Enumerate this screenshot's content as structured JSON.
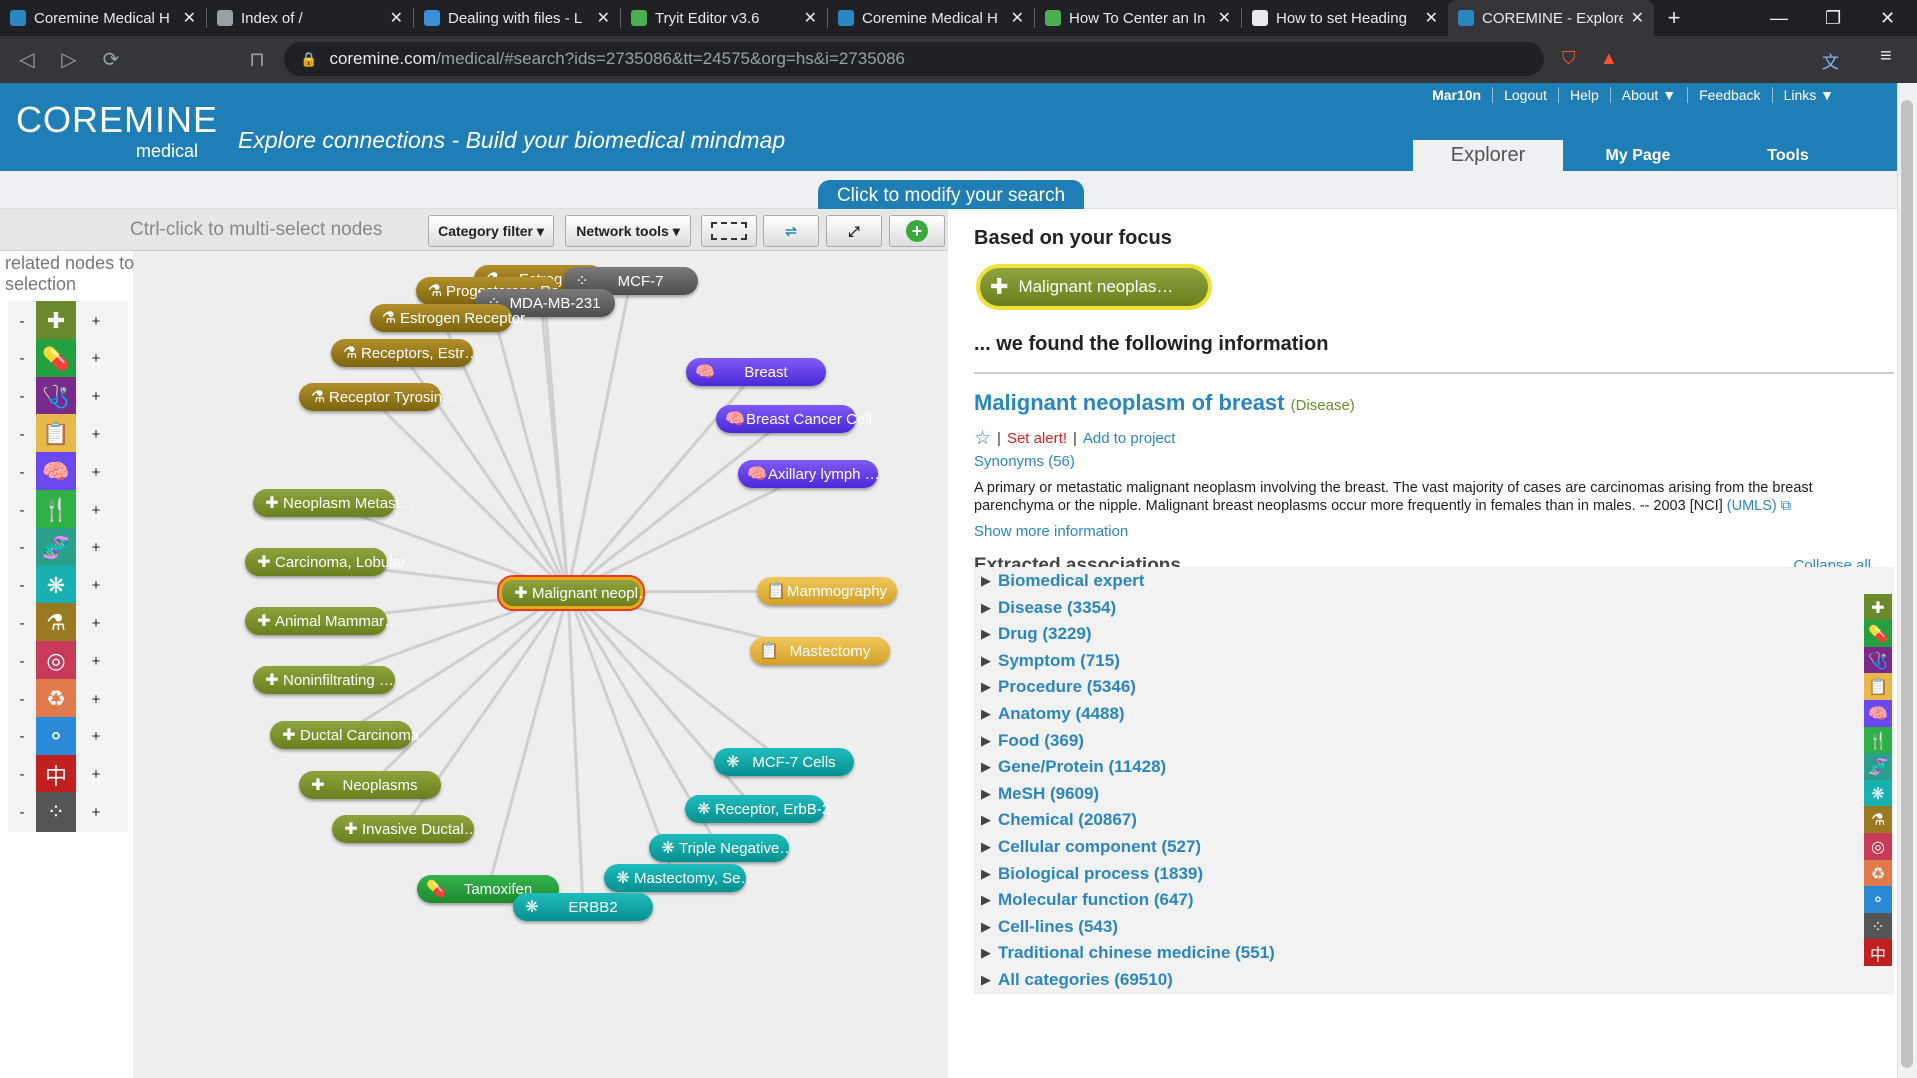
{
  "browser": {
    "tabs": [
      {
        "title": "Coremine Medical H",
        "color": "#2a86c2"
      },
      {
        "title": "Index of /",
        "color": "#9aa0a6"
      },
      {
        "title": "Dealing with files - L",
        "color": "#3b8ed8"
      },
      {
        "title": "Tryit Editor v3.6",
        "color": "#4caf50"
      },
      {
        "title": "Coremine Medical H",
        "color": "#2a86c2"
      },
      {
        "title": "How To Center an In",
        "color": "#4caf50"
      },
      {
        "title": "How to set Heading",
        "color": "#e8eaed"
      },
      {
        "title": "COREMINE - Explore",
        "color": "#2a86c2"
      }
    ],
    "url_host": "coremine.com",
    "url_path": "/medical/#search?ids=2735086&tt=24575&org=hs&i=2735086"
  },
  "header": {
    "logo_main": "COREMINE",
    "logo_sub": "medical",
    "tagline": "Explore connections - Build your biomedical mindmap",
    "links": [
      "Mar10n",
      "Logout",
      "Help",
      "About ▼",
      "Feedback",
      "Links ▼"
    ],
    "nav_tabs": [
      "Explorer",
      "My Page",
      "Tools"
    ]
  },
  "modify_search": "Click to modify your search",
  "left": {
    "hint": "Ctrl-click to multi-select nodes",
    "category_filter": "Category filter",
    "network_tools": "Network tools",
    "sidebar_title": "related nodes to selection",
    "categories": [
      {
        "icon": "✚",
        "color": "#6b8a2d"
      },
      {
        "icon": "💊",
        "color": "#25a040"
      },
      {
        "icon": "🩺",
        "color": "#7a2a8a"
      },
      {
        "icon": "📋",
        "color": "#e7b94a"
      },
      {
        "icon": "🧠",
        "color": "#6a4af0"
      },
      {
        "icon": "🍴",
        "color": "#2fb044"
      },
      {
        "icon": "🧬",
        "color": "#2aa08a"
      },
      {
        "icon": "❋",
        "color": "#18b0b0"
      },
      {
        "icon": "⚗",
        "color": "#9a7a20"
      },
      {
        "icon": "◎",
        "color": "#c83a5a"
      },
      {
        "icon": "♻",
        "color": "#e07a4a"
      },
      {
        "icon": "⚬",
        "color": "#2a8ad8"
      },
      {
        "icon": "中",
        "color": "#c02020"
      },
      {
        "icon": "⁘",
        "color": "#555555"
      }
    ]
  },
  "graph": {
    "center": "Malignant neopl…",
    "nodes": [
      {
        "label": "Estrogen",
        "icon": "⚗",
        "cat": "chem"
      },
      {
        "label": "Progesterone Re…",
        "icon": "⚗",
        "cat": "chem"
      },
      {
        "label": "MCF-7",
        "icon": "⁘",
        "cat": "cell"
      },
      {
        "label": "MDA-MB-231",
        "icon": "⁘",
        "cat": "cell"
      },
      {
        "label": "Estrogen Receptor",
        "icon": "⚗",
        "cat": "chem"
      },
      {
        "label": "Receptors, Estr…",
        "icon": "⚗",
        "cat": "chem"
      },
      {
        "label": "Receptor Tyrosin…",
        "icon": "⚗",
        "cat": "chem"
      },
      {
        "label": "Breast",
        "icon": "🧠",
        "cat": "anat"
      },
      {
        "label": "Breast Cancer Cell",
        "icon": "🧠",
        "cat": "anat"
      },
      {
        "label": "Axillary lymph …",
        "icon": "🧠",
        "cat": "anat"
      },
      {
        "label": "Neoplasm Metast…",
        "icon": "✚",
        "cat": "dis"
      },
      {
        "label": "Carcinoma, Lobular",
        "icon": "✚",
        "cat": "dis"
      },
      {
        "label": "Mammography",
        "icon": "📋",
        "cat": "proc"
      },
      {
        "label": "Animal Mammar…",
        "icon": "✚",
        "cat": "dis"
      },
      {
        "label": "Mastectomy",
        "icon": "📋",
        "cat": "proc"
      },
      {
        "label": "Noninfiltrating …",
        "icon": "✚",
        "cat": "dis"
      },
      {
        "label": "Ductal Carcinoma",
        "icon": "✚",
        "cat": "dis"
      },
      {
        "label": "MCF-7 Cells",
        "icon": "❋",
        "cat": "mesh"
      },
      {
        "label": "Neoplasms",
        "icon": "✚",
        "cat": "dis"
      },
      {
        "label": "Receptor, ErbB-2",
        "icon": "❋",
        "cat": "mesh"
      },
      {
        "label": "Invasive Ductal…",
        "icon": "✚",
        "cat": "dis"
      },
      {
        "label": "Triple Negative…",
        "icon": "❋",
        "cat": "mesh"
      },
      {
        "label": "Mastectomy, Se…",
        "icon": "❋",
        "cat": "mesh"
      },
      {
        "label": "Tamoxifen",
        "icon": "💊",
        "cat": "drug"
      },
      {
        "label": "ERBB2",
        "icon": "❋",
        "cat": "mesh"
      }
    ]
  },
  "right": {
    "based_on": "Based on your focus",
    "focus_label": "Malignant neoplas…",
    "found": "... we found the following information",
    "title": "Malignant neoplasm of breast",
    "type": "(Disease)",
    "set_alert": "Set alert!",
    "add_project": "Add to project",
    "synonyms": "Synonyms (56)",
    "description": "A primary or metastatic malignant neoplasm involving the breast. The vast majority of cases are carcinomas arising from the breast parenchyma or the nipple. Malignant breast neoplasms occur more frequently in females than in males. -- 2003 [NCI]",
    "umls": "(UMLS)",
    "show_more": "Show more information",
    "extracted": "Extracted associations",
    "collapse_all": "Collapse all",
    "associations": [
      {
        "label": "Biomedical expert",
        "icon": "",
        "color": ""
      },
      {
        "label": "Disease (3354)",
        "icon": "✚",
        "color": "#6b8a2d"
      },
      {
        "label": "Drug (3229)",
        "icon": "💊",
        "color": "#25a040"
      },
      {
        "label": "Symptom (715)",
        "icon": "🩺",
        "color": "#7a2a8a"
      },
      {
        "label": "Procedure (5346)",
        "icon": "📋",
        "color": "#e7b94a"
      },
      {
        "label": "Anatomy (4488)",
        "icon": "🧠",
        "color": "#6a4af0"
      },
      {
        "label": "Food (369)",
        "icon": "🍴",
        "color": "#2fb044"
      },
      {
        "label": "Gene/Protein (11428)",
        "icon": "🧬",
        "color": "#2aa08a"
      },
      {
        "label": "MeSH (9609)",
        "icon": "❋",
        "color": "#18b0b0"
      },
      {
        "label": "Chemical (20867)",
        "icon": "⚗",
        "color": "#9a7a20"
      },
      {
        "label": "Cellular component (527)",
        "icon": "◎",
        "color": "#c83a5a"
      },
      {
        "label": "Biological process (1839)",
        "icon": "♻",
        "color": "#e07a4a"
      },
      {
        "label": "Molecular function (647)",
        "icon": "⚬",
        "color": "#2a8ad8"
      },
      {
        "label": "Cell-lines (543)",
        "icon": "⁘",
        "color": "#555555"
      },
      {
        "label": "Traditional chinese medicine (551)",
        "icon": "中",
        "color": "#c02020"
      },
      {
        "label": "All categories (69510)",
        "icon": "",
        "color": ""
      }
    ]
  }
}
